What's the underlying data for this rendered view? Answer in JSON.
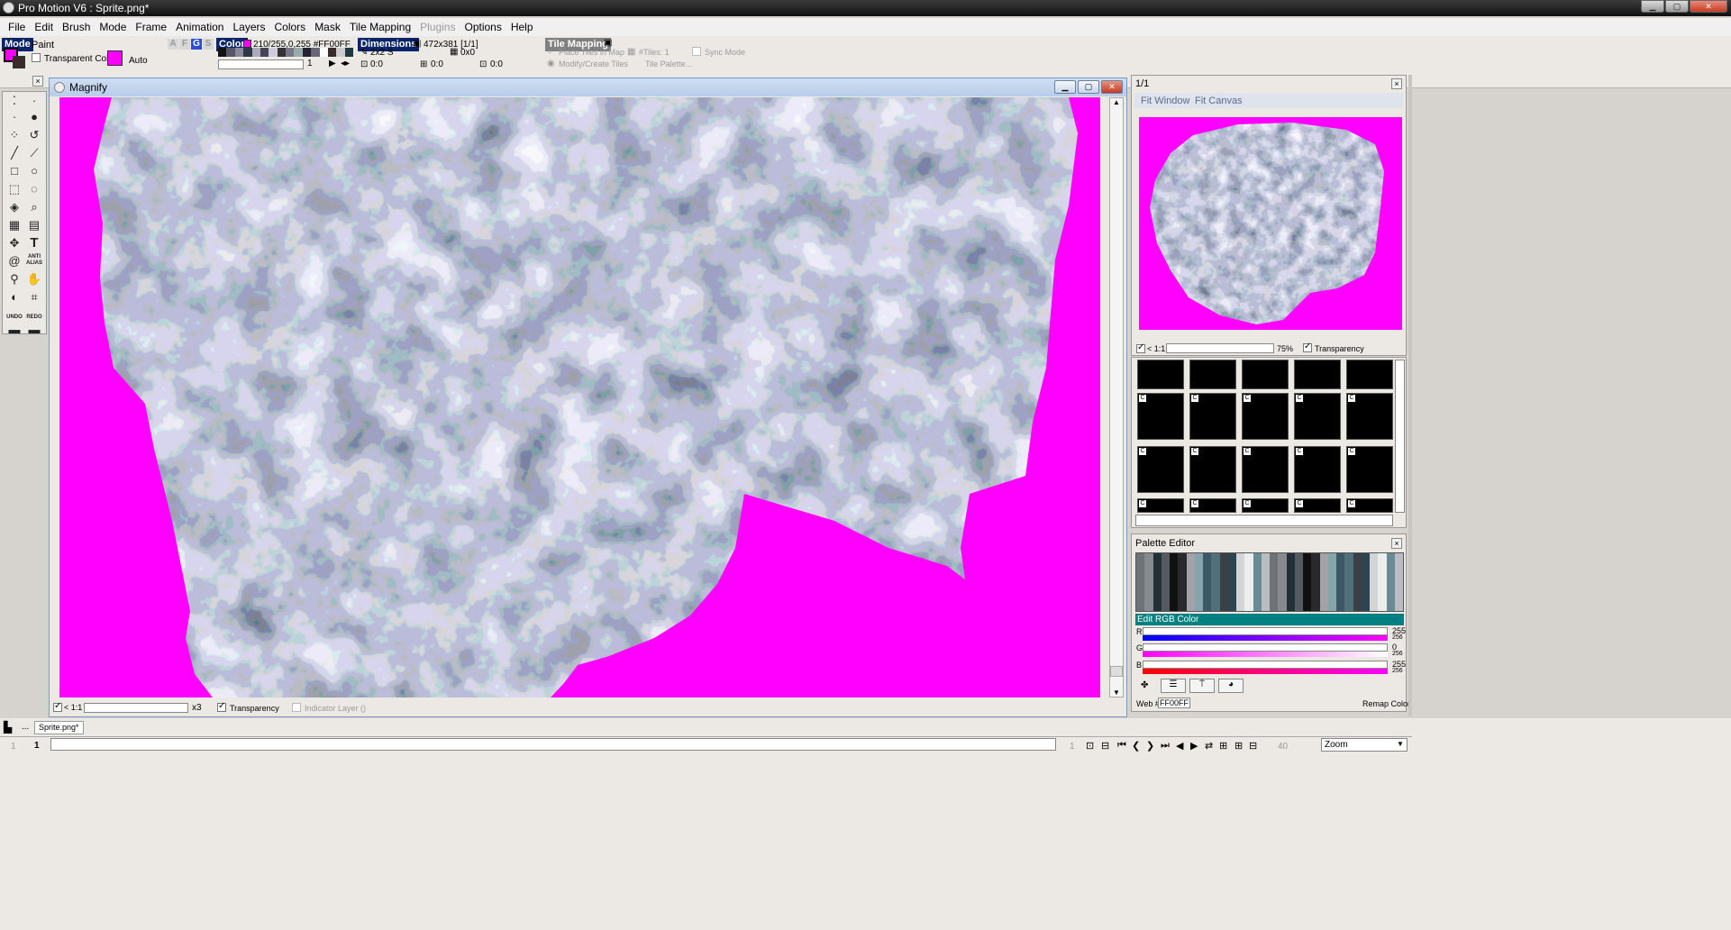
{
  "window": {
    "title": "Pro Motion V6 : Sprite.png*",
    "controls": [
      "minimize",
      "maximize",
      "close"
    ]
  },
  "menu": {
    "items": [
      "File",
      "Edit",
      "Brush",
      "Mode",
      "Frame",
      "Animation",
      "Layers",
      "Colors",
      "Mask",
      "Tile Mapping",
      "Plugins",
      "Options",
      "Help"
    ],
    "disabled_items": [
      "Plugins"
    ]
  },
  "toolbar": {
    "mode_label": "Mode",
    "mode_value": "Paint",
    "afgs_buttons": [
      "A",
      "F",
      "G",
      "S"
    ],
    "color_label": "Color",
    "color_value": "210/255,0,255 #FF00FF",
    "transparent_label": "Transparent Color:",
    "transparent_mode": "Auto",
    "palette_index": "1",
    "dimensions_label": "Dimensions",
    "dimensions_value": "472x381 [1/1]",
    "brush_size": "2x2 S",
    "offset": "0x0",
    "coords_a": "0:0",
    "coords_b": "0:0",
    "coords_c": "0:0",
    "tile_mapping_label": "Tile Mapping",
    "place_tiles": "Place Tiles in Map",
    "modify_tiles": "Modify/Create Tiles",
    "tiles_count": "#Tiles: 1",
    "tile_palette": "Tile Palette...",
    "sync_mode": "Sync Mode",
    "colors": {
      "fg": "#ff00ff",
      "bg": "#3a2a2a",
      "transparent": "#ff00ff"
    }
  },
  "toolbox": {
    "tools": [
      "dot-brush",
      "dot-brush-2",
      "line-tool",
      "curve-tool",
      "rectangle-tool",
      "ellipse-tool",
      "select-tool",
      "lasso-tool",
      "fill-tool",
      "zoom-tool",
      "grid-tool",
      "page-tool",
      "stamp-tool",
      "text-tool",
      "spiral-tool",
      "anti-alias-tool",
      "eyedropper-tool",
      "hand-tool",
      "mask-tool",
      "crop-tool",
      "undo",
      "redo",
      "bar-a",
      "bar-b"
    ],
    "text_tool_glyph": "T",
    "anti_alias_label": "ANTI ALIAS",
    "undo_label": "UNDO",
    "redo_label": "REDO"
  },
  "magnify": {
    "title": "Magnify",
    "zoom_ratio": "< 1:1",
    "zoom_factor": "x3",
    "transparency_label": "Transparency",
    "transparency_checked": true,
    "indicator_label": "Indicator Layer ()",
    "indicator_checked": false,
    "background_color": "#ff00ff"
  },
  "preview": {
    "title": "1/1",
    "fit_window": "Fit Window",
    "fit_canvas": "Fit Canvas",
    "zoom_ratio": "< 1:1",
    "zoom_percent": "75%",
    "transparency_label": "Transparency",
    "transparency_checked": true
  },
  "tiles": {
    "marker": "C",
    "rows": 4,
    "cols": 5
  },
  "palette_editor": {
    "title": "Palette Editor",
    "edit_rgb_label": "Edit RGB Color",
    "r_label": "R",
    "g_label": "G",
    "b_label": "B",
    "r_value": "255",
    "g_value": "0",
    "b_value": "255",
    "max_value": "256",
    "web_label": "Web #",
    "web_value": "FF00FF",
    "remap_label": "Remap Color",
    "accent": "#008080"
  },
  "statusbar": {
    "tab_label": "Sprite.png*",
    "frame_number_left": "1",
    "frame_number_current": "1",
    "frame_number_right": "1",
    "frame_total": "40",
    "zoom_mode": "Zoom",
    "dots": "..."
  }
}
